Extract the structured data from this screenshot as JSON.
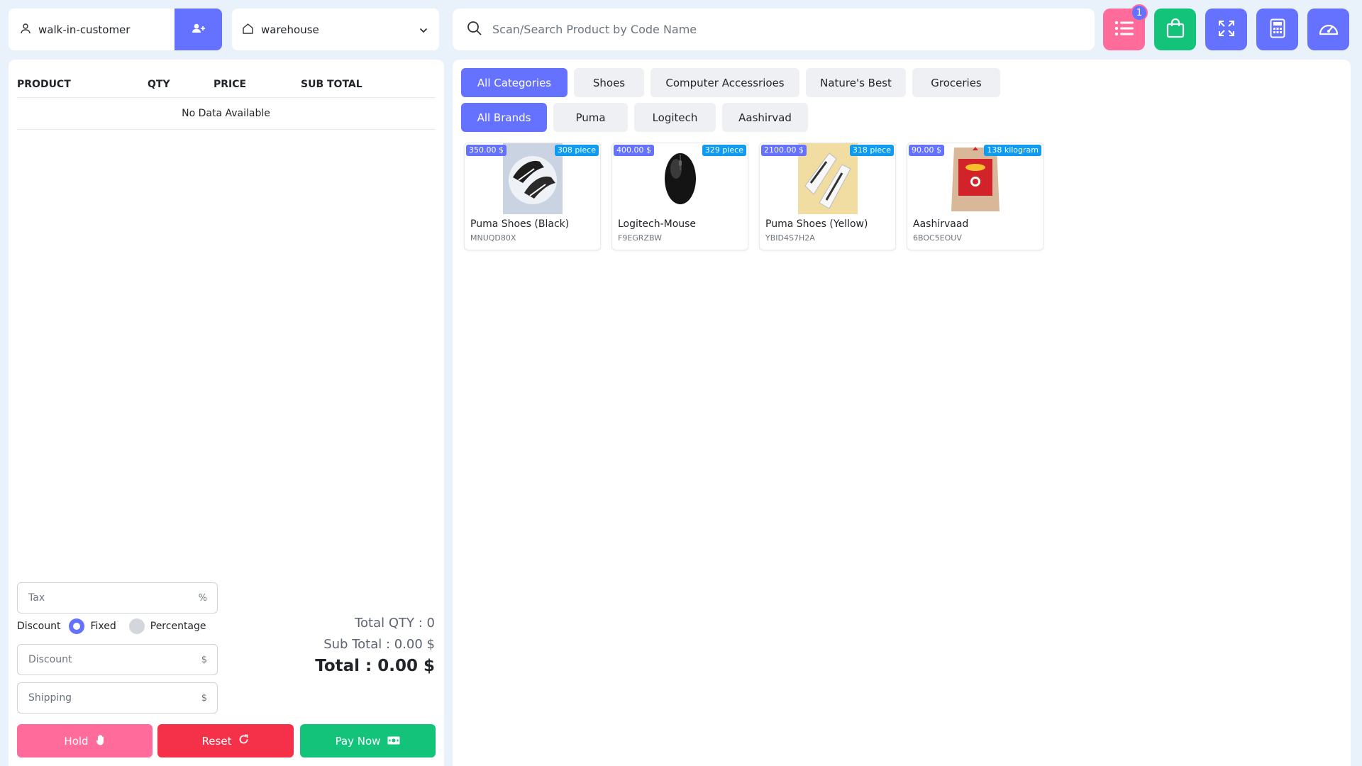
{
  "customer": {
    "value": "walk-in-customer"
  },
  "warehouse": {
    "value": "warehouse"
  },
  "search": {
    "placeholder": "Scan/Search Product by Code Name"
  },
  "top_buttons": {
    "list_badge": "1"
  },
  "cart": {
    "columns": [
      "PRODUCT",
      "QTY",
      "PRICE",
      "SUB TOTAL"
    ],
    "empty_text": "No Data Available",
    "tax_placeholder": "Tax",
    "tax_suffix": "%",
    "discount_label": "Discount",
    "discount_options": [
      "Fixed",
      "Percentage"
    ],
    "discount_selected": "Fixed",
    "discount_placeholder": "Discount",
    "discount_suffix": "$",
    "shipping_placeholder": "Shipping",
    "shipping_suffix": "$",
    "total_qty": "Total QTY : 0",
    "sub_total": "Sub Total : 0.00 $",
    "total": "Total : 0.00 $",
    "buttons": {
      "hold": "Hold",
      "reset": "Reset",
      "pay": "Pay Now"
    }
  },
  "categories": [
    "All Categories",
    "Shoes",
    "Computer Accessrioes",
    "Nature's Best",
    "Groceries"
  ],
  "brands": [
    "All Brands",
    "Puma",
    "Logitech",
    "Aashirvad"
  ],
  "products": [
    {
      "name": "Puma Shoes (Black)",
      "code": "MNUQD80X",
      "price": "350.00 $",
      "stock": "308 piece",
      "icon": "black-shoes-image"
    },
    {
      "name": "Logitech-Mouse",
      "code": "F9EGRZBW",
      "price": "400.00 $",
      "stock": "329 piece",
      "icon": "mouse-image"
    },
    {
      "name": "Puma Shoes (Yellow)",
      "code": "YBID4S7H2A",
      "price": "2100.00 $",
      "stock": "318 piece",
      "icon": "yellow-shoes-image"
    },
    {
      "name": "Aashirvaad",
      "code": "6BOC5EOUV",
      "price": "90.00 $",
      "stock": "138 kilogram",
      "icon": "flour-bag-image"
    }
  ],
  "colors": {
    "primary": "#6571ff",
    "pink": "#ff6b9a",
    "green": "#13c37a",
    "red": "#f5314a",
    "stock_tag": "#0d9cf2"
  }
}
